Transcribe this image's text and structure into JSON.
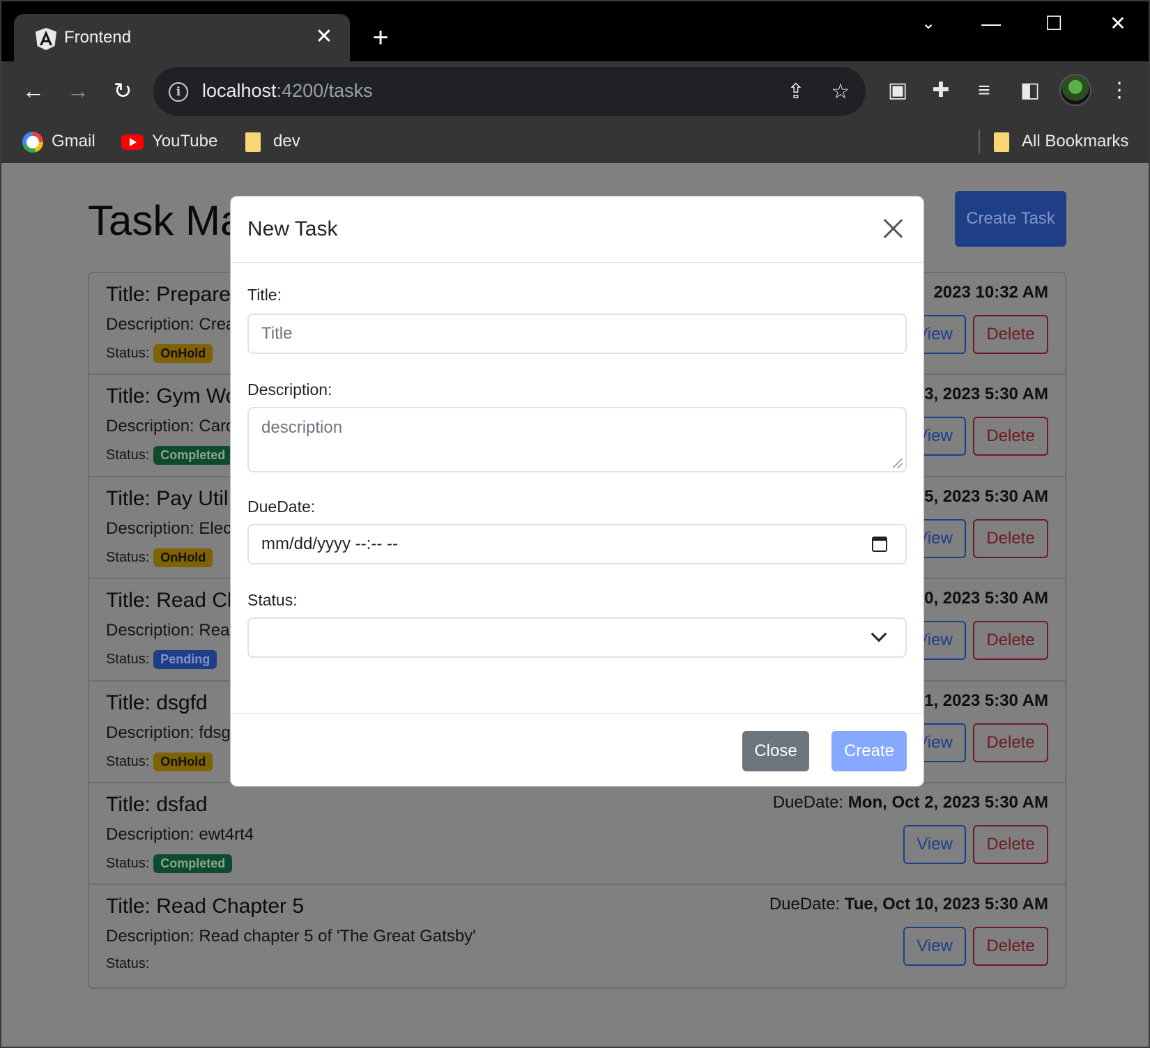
{
  "browser": {
    "tab_title": "Frontend",
    "url_host": "localhost",
    "url_path": ":4200/tasks",
    "bookmarks": [
      "Gmail",
      "YouTube",
      "dev"
    ],
    "all_bookmarks": "All Bookmarks"
  },
  "page": {
    "title": "Task Ma",
    "create_button": "Create Task",
    "status_label": "Status:",
    "due_label": "DueDate:",
    "view_label": "View",
    "delete_label": "Delete",
    "tasks": [
      {
        "title": "Title: Prepare",
        "desc": "Description: Crea",
        "status": "OnHold",
        "status_kind": "onhold",
        "due_prefix": "",
        "due": "2023 10:32 AM"
      },
      {
        "title": "Title: Gym Wo",
        "desc": "Description: Card",
        "status": "Completed",
        "status_kind": "completed",
        "due_prefix": "",
        "due": "3, 2023 5:30 AM"
      },
      {
        "title": "Title: Pay Util",
        "desc": "Description: Elect",
        "status": "OnHold",
        "status_kind": "onhold",
        "due_prefix": "",
        "due": "5, 2023 5:30 AM"
      },
      {
        "title": "Title: Read Ch",
        "desc": "Description: Read",
        "status": "Pending",
        "status_kind": "pending",
        "due_prefix": "",
        "due": "0, 2023 5:30 AM"
      },
      {
        "title": "Title: dsgfd",
        "desc": "Description: fdsg",
        "status": "OnHold",
        "status_kind": "onhold",
        "due_prefix": "",
        "due": "1, 2023 5:30 AM"
      },
      {
        "title": "Title: dsfad",
        "desc": "Description: ewt4rt4",
        "status": "Completed",
        "status_kind": "completed",
        "due_prefix": "DueDate:",
        "due": "Mon, Oct 2, 2023 5:30 AM"
      },
      {
        "title": "Title: Read Chapter 5",
        "desc": "Description: Read chapter 5 of 'The Great Gatsby'",
        "status": "",
        "status_kind": "",
        "due_prefix": "DueDate:",
        "due": "Tue, Oct 10, 2023 5:30 AM"
      }
    ]
  },
  "modal": {
    "title": "New Task",
    "title_label": "Title:",
    "title_placeholder": "Title",
    "description_label": "Description:",
    "description_placeholder": "description",
    "duedate_label": "DueDate:",
    "duedate_value": "mm/dd/yyyy --:-- --",
    "status_label": "Status:",
    "status_value": "",
    "close_button": "Close",
    "create_button": "Create"
  }
}
